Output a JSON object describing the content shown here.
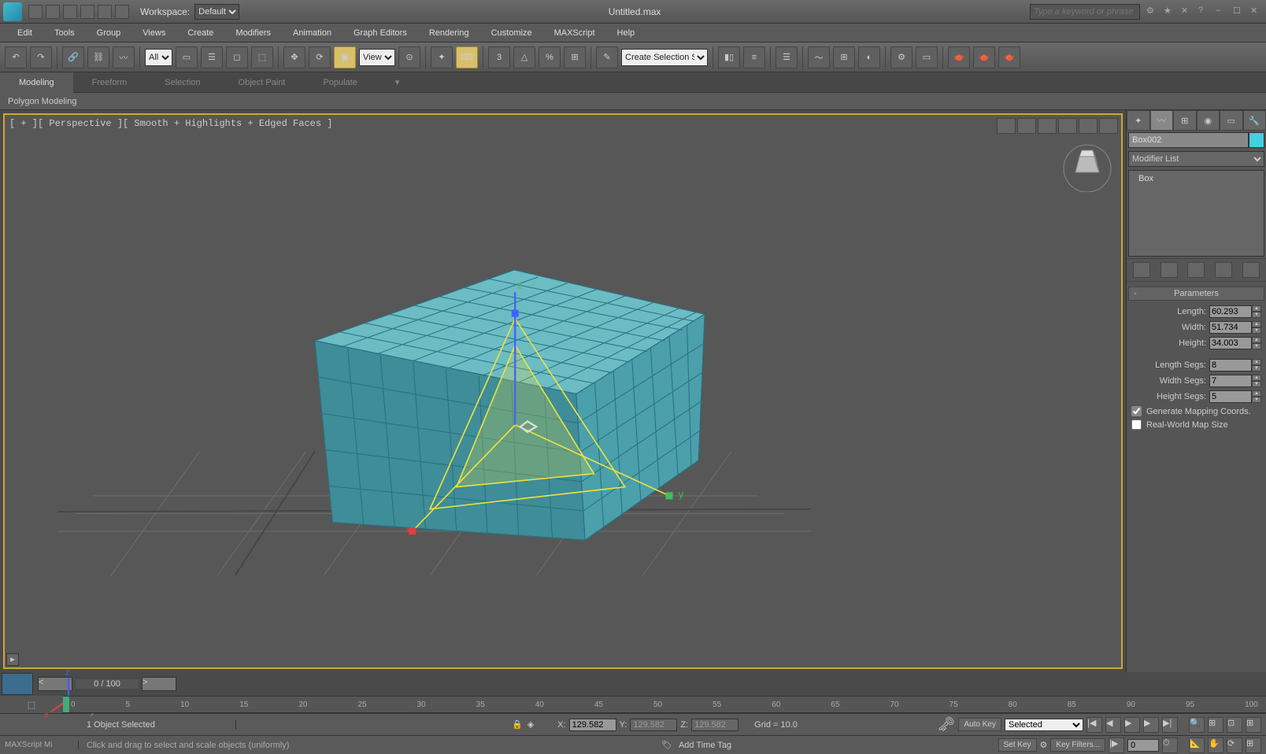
{
  "titlebar": {
    "workspace_label": "Workspace:",
    "workspace_value": "Default",
    "document_title": "Untitled.max",
    "search_placeholder": "Type a keyword or phrase"
  },
  "menu": [
    "Edit",
    "Tools",
    "Group",
    "Views",
    "Create",
    "Modifiers",
    "Animation",
    "Graph Editors",
    "Rendering",
    "Customize",
    "MAXScript",
    "Help"
  ],
  "toolbar": {
    "selection_filter": "All",
    "ref_coord": "View",
    "named_selection": "Create Selection Se"
  },
  "ribbon": {
    "tabs": [
      "Modeling",
      "Freeform",
      "Selection",
      "Object Paint",
      "Populate"
    ],
    "active": 0,
    "sub_label": "Polygon Modeling"
  },
  "viewport": {
    "label": "[ + ][ Perspective ][ Smooth + Highlights + Edged Faces ]"
  },
  "modify_panel": {
    "object_name": "Box002",
    "modifier_list_label": "Modifier List",
    "stack": [
      "Box"
    ],
    "rollout_title": "Parameters",
    "params": {
      "length_label": "Length:",
      "length": "60.293",
      "width_label": "Width:",
      "width": "51.734",
      "height_label": "Height:",
      "height": "34.003",
      "lsegs_label": "Length Segs:",
      "lsegs": "8",
      "wsegs_label": "Width Segs:",
      "wsegs": "7",
      "hsegs_label": "Height Segs:",
      "hsegs": "5",
      "gen_map": "Generate Mapping Coords.",
      "real_world": "Real-World Map Size"
    }
  },
  "timeline": {
    "frame_display": "0 / 100",
    "ticks": [
      "0",
      "5",
      "10",
      "15",
      "20",
      "25",
      "30",
      "35",
      "40",
      "45",
      "50",
      "55",
      "60",
      "65",
      "70",
      "75",
      "80",
      "85",
      "90",
      "95",
      "100"
    ]
  },
  "status": {
    "selection": "1 Object Selected",
    "x_label": "X:",
    "x": "129.582",
    "y_label": "Y:",
    "y": "129.582",
    "z_label": "Z:",
    "z": "129.582",
    "grid": "Grid = 10.0",
    "auto_key": "Auto Key",
    "set_key": "Set Key",
    "key_mode": "Selected",
    "key_filters": "Key Filters...",
    "frame_in": "0",
    "prompt": "Click and drag to select and scale objects (uniformly)",
    "add_time_tag": "Add Time Tag",
    "maxscript": "MAXScript Mi"
  }
}
